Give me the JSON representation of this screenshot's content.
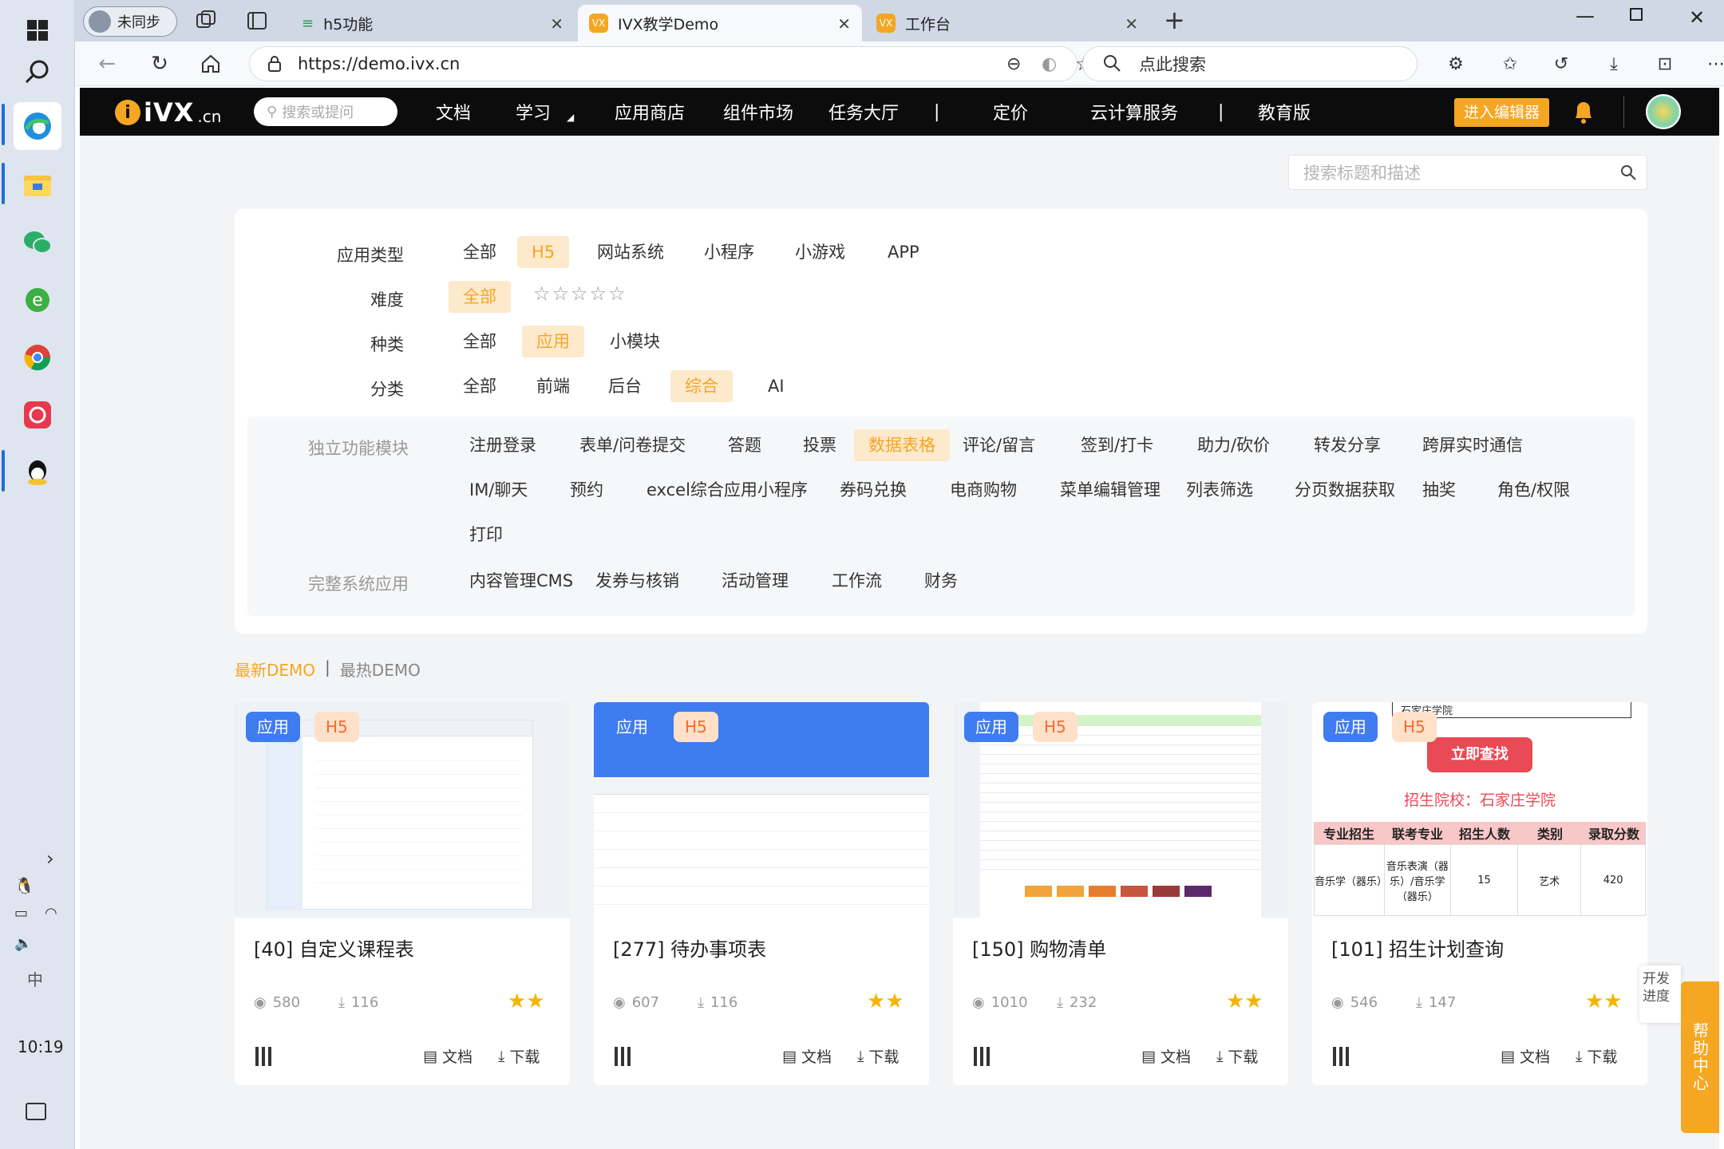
{
  "taskbar": {
    "time": "10:19",
    "ime": "中"
  },
  "tabs": [
    {
      "label": "未同步"
    },
    {
      "label": "h5功能"
    },
    {
      "label": "IVX教学Demo"
    },
    {
      "label": "工作台"
    }
  ],
  "address": {
    "url": "https://demo.ivx.cn",
    "search_placeholder": "点此搜索"
  },
  "site_nav": {
    "logo": "iVX",
    "logo_suffix": ".cn",
    "search_placeholder": "搜索或提问",
    "items": [
      "文档",
      "学习",
      "应用商店",
      "组件市场",
      "任务大厅",
      "|",
      "定价",
      "云计算服务",
      "|",
      "教育版"
    ],
    "editor_button": "进入编辑器"
  },
  "page_search_placeholder": "搜索标题和描述",
  "filters": {
    "app_type": {
      "label": "应用类型",
      "options": [
        "全部",
        "H5",
        "网站系统",
        "小程序",
        "小游戏",
        "APP"
      ]
    },
    "difficulty": {
      "label": "难度",
      "options": [
        "全部"
      ],
      "stars": "☆☆☆☆☆"
    },
    "kind": {
      "label": "种类",
      "options": [
        "全部",
        "应用",
        "小模块"
      ]
    },
    "category": {
      "label": "分类",
      "options": [
        "全部",
        "前端",
        "后台",
        "综合",
        "AI"
      ]
    },
    "independent": {
      "label": "独立功能模块",
      "row1": [
        "注册登录",
        "表单/问卷提交",
        "答题",
        "投票",
        "数据表格",
        "评论/留言",
        "签到/打卡",
        "助力/砍价",
        "转发分享",
        "跨屏实时通信"
      ],
      "row2": [
        "IM/聊天",
        "预约",
        "excel综合应用小程序",
        "券码兑换",
        "电商购物",
        "菜单编辑管理",
        "列表筛选",
        "分页数据获取",
        "抽奖",
        "角色/权限"
      ],
      "row3": [
        "打印"
      ]
    },
    "complete": {
      "label": "完整系统应用",
      "options": [
        "内容管理CMS",
        "发券与核销",
        "活动管理",
        "工作流",
        "财务"
      ]
    }
  },
  "sort": {
    "latest": "最新DEMO",
    "sep": "|",
    "hottest": "最热DEMO"
  },
  "cards": [
    {
      "badge1": "应用",
      "badge2": "H5",
      "title": "[40] 自定义课程表",
      "views": "580",
      "downloads": "116",
      "doc": "文档",
      "download": "下载"
    },
    {
      "badge1": "应用",
      "badge2": "H5",
      "title": "[277] 待办事项表",
      "views": "607",
      "downloads": "116",
      "doc": "文档",
      "download": "下载"
    },
    {
      "badge1": "应用",
      "badge2": "H5",
      "title": "[150] 购物清单",
      "views": "1010",
      "downloads": "232",
      "doc": "文档",
      "download": "下载"
    },
    {
      "badge1": "应用",
      "badge2": "H5",
      "title": "[101] 招生计划查询",
      "views": "546",
      "downloads": "147",
      "doc": "文档",
      "download": "下载"
    }
  ],
  "card4_thumb": {
    "button": "立即查找",
    "school": "招生院校：石家庄学院",
    "school_select": "石家庄学院",
    "headers": [
      "专业招生",
      "联考专业",
      "招生人数",
      "类别",
      "录取分数"
    ],
    "row": [
      "音乐学（器乐）",
      "音乐表演（器乐）/音乐学（器乐）",
      "15",
      "艺术",
      "420"
    ]
  },
  "floating": {
    "dev_progress": "开发进度",
    "help": "帮助中心"
  },
  "colors": {
    "accent": "#f5a623",
    "blue": "#3f7cf0",
    "nav_bg": "#0c0c0c"
  }
}
